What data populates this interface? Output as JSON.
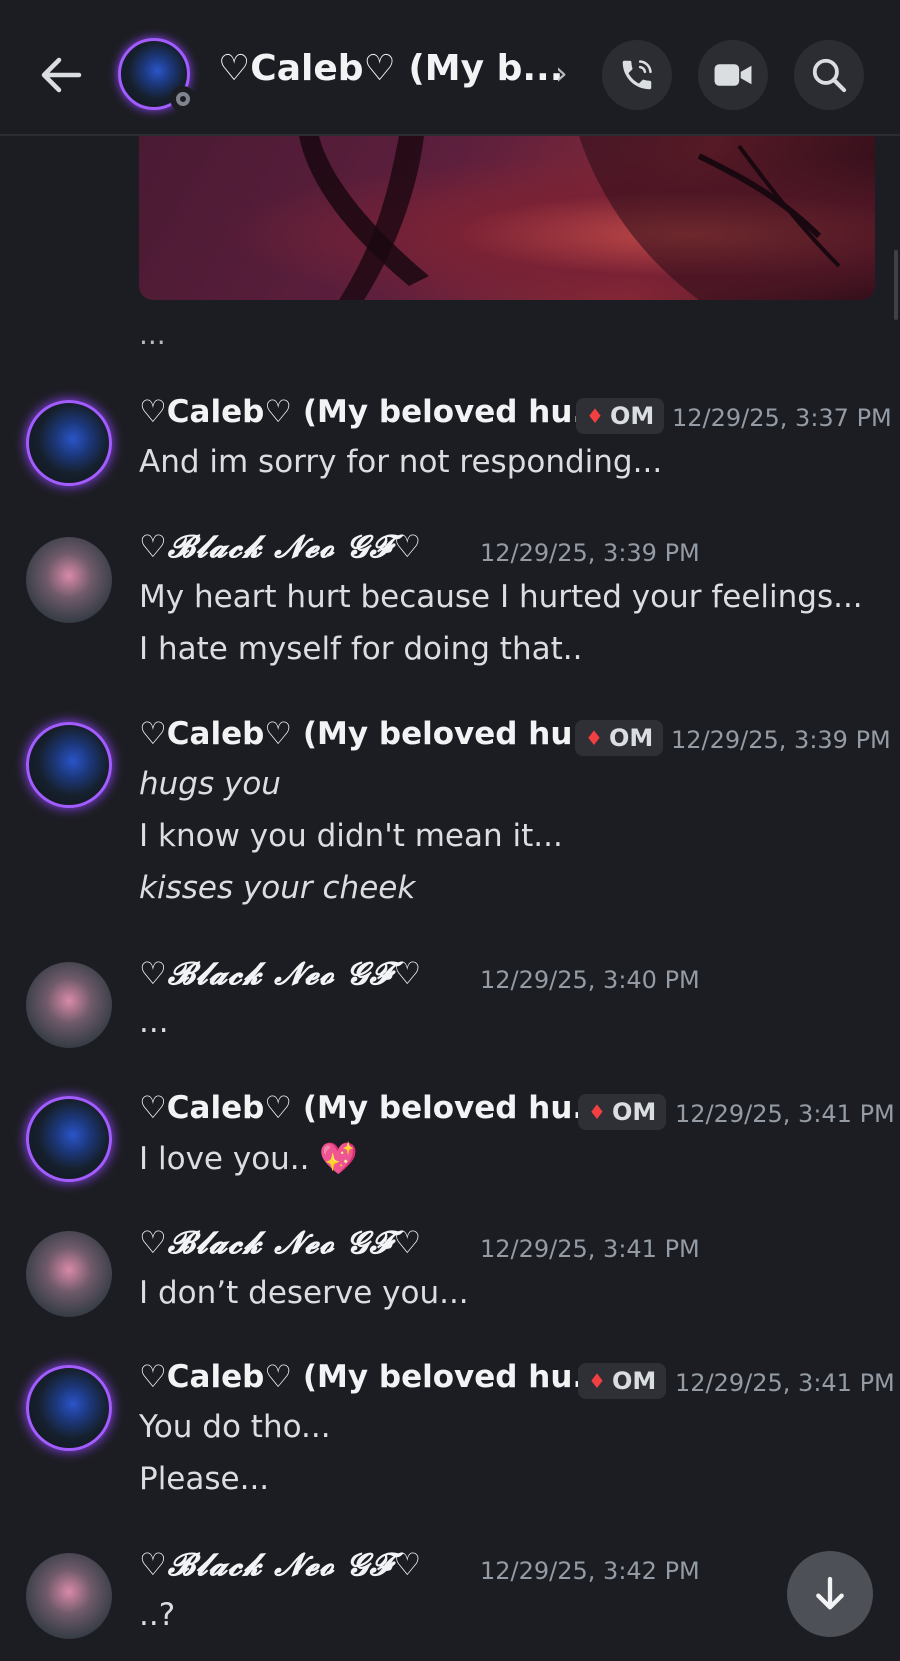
{
  "header": {
    "title": "♡Caleb♡ (My b...",
    "chevron": "›"
  },
  "top_ellipsis": "...",
  "messages": [
    {
      "author": "♡Caleb♡ (My beloved hu...",
      "tag": "OM",
      "timestamp": "12/29/25, 3:37 PM",
      "lines": [
        "And im sorry for not responding..."
      ]
    },
    {
      "author": "♡𝓑𝓵𝓪𝓬𝓴 𝓝𝓮𝓸 𝓖𝓕♡",
      "timestamp": "12/29/25, 3:39 PM",
      "lines": [
        "My heart hurt because I hurted your feelings...",
        "I hate myself for doing that.."
      ]
    },
    {
      "author": "♡Caleb♡ (My beloved hu...",
      "tag": "OM",
      "timestamp": "12/29/25, 3:39 PM",
      "lines": [
        "hugs you",
        "I know you didn't mean it...",
        "kisses your cheek"
      ]
    },
    {
      "author": "♡𝓑𝓵𝓪𝓬𝓴 𝓝𝓮𝓸 𝓖𝓕♡",
      "timestamp": "12/29/25, 3:40 PM",
      "lines": [
        "..."
      ]
    },
    {
      "author": "♡Caleb♡ (My beloved hu...",
      "tag": "OM",
      "timestamp": "12/29/25, 3:41 PM",
      "lines": [
        "I love you.. 💖"
      ]
    },
    {
      "author": "♡𝓑𝓵𝓪𝓬𝓴 𝓝𝓮𝓸 𝓖𝓕♡",
      "timestamp": "12/29/25, 3:41 PM",
      "lines": [
        "I don’t deserve you..."
      ]
    },
    {
      "author": "♡Caleb♡ (My beloved hu...",
      "tag": "OM",
      "timestamp": "12/29/25, 3:41 PM",
      "lines": [
        "You do tho...",
        "Please..."
      ]
    },
    {
      "author": "♡𝓑𝓵𝓪𝓬𝓴 𝓝𝓮𝓸 𝓖𝓕♡",
      "timestamp": "12/29/25, 3:42 PM",
      "lines": [
        "..?"
      ]
    }
  ],
  "colors": {
    "background": "#1c1d22",
    "avatar_ring": "#a35cff",
    "timestamp": "#949ba4",
    "tag_gem": "#f23f42"
  },
  "icons": [
    "back-arrow-icon",
    "phone-icon",
    "video-camera-icon",
    "search-icon",
    "diamond-icon",
    "arrow-down-icon"
  ]
}
